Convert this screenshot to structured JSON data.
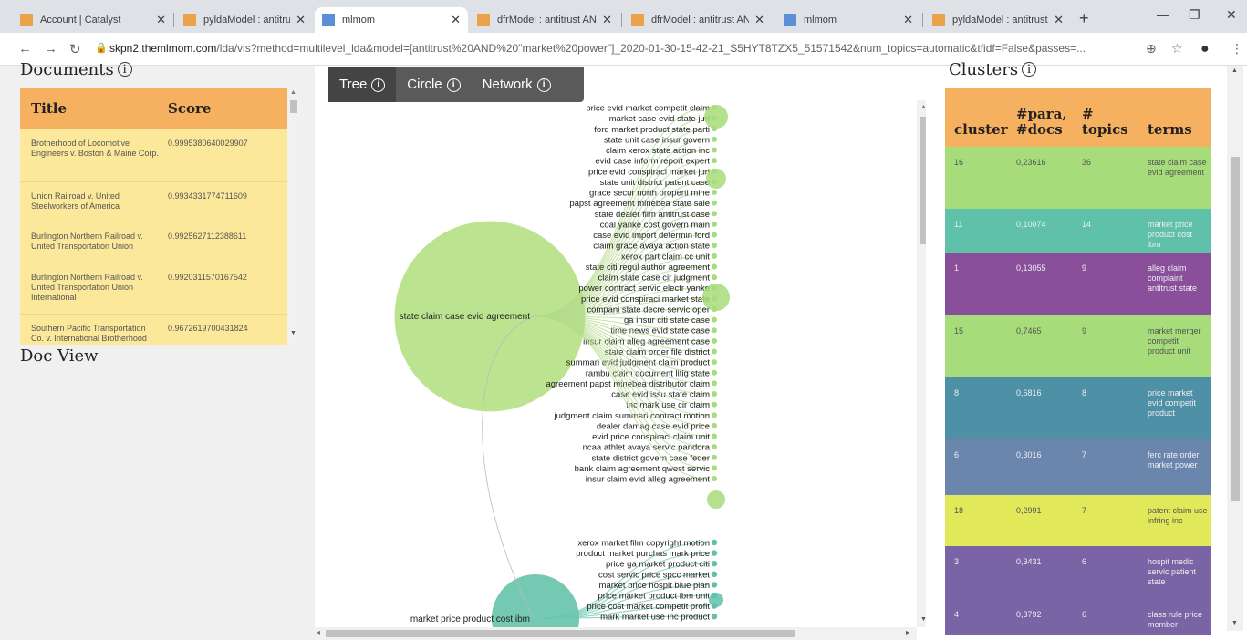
{
  "browser": {
    "tabs": [
      {
        "label": "Account | Catalyst",
        "active": false
      },
      {
        "label": "pyldaModel : antitrust",
        "active": false
      },
      {
        "label": "mlmom",
        "active": true
      },
      {
        "label": "dfrModel : antitrust AN",
        "active": false
      },
      {
        "label": "dfrModel : antitrust AN",
        "active": false
      },
      {
        "label": "mlmom",
        "active": false
      },
      {
        "label": "pyldaModel : antitrust",
        "active": false
      }
    ],
    "url_host": "skpn2.themlmom.com",
    "url_rest": "/lda/vis?method=multilevel_lda&model=[antitrust%20AND%20\"market%20power\"]_2020-01-30-15-42-21_S5HYT8TZX5_51571542&num_topics=automatic&tfidf=False&passes=..."
  },
  "documents": {
    "heading": "Documents",
    "col_title": "Title",
    "col_score": "Score",
    "rows": [
      {
        "title": "Brotherhood of Locomotive Engineers v. Boston & Maine Corp.",
        "score": "0.9995380640029907"
      },
      {
        "title": "Union Railroad v. United Steelworkers of America",
        "score": "0.9934331774711609"
      },
      {
        "title": "Burlington Northern Railroad v. United Transportation Union",
        "score": "0.9925627112388611"
      },
      {
        "title": "Burlington Northern Railroad v. United Transportation Union International",
        "score": "0.9920311570167542"
      },
      {
        "title": "Southern Pacific Transportation Co. v. International Brotherhood",
        "score": "0.9672619700431824"
      }
    ]
  },
  "docview": {
    "heading": "Doc View"
  },
  "viz": {
    "tabs": [
      {
        "label": "Tree",
        "active": true
      },
      {
        "label": "Circle",
        "active": false
      },
      {
        "label": "Network",
        "active": false
      }
    ],
    "root1": "state claim case evid agreement",
    "root2": "market price product cost ibm",
    "leaves1": [
      "price evid market competit claim",
      "market case evid state juri",
      "ford market product state parti",
      "state unit case insur govern",
      "claim xerox state action inc",
      "evid case inform report expert",
      "price evid conspiraci market juri",
      "state unit district patent case",
      "grace secur north properti mine",
      "papst agreement minebea state sale",
      "state dealer film antitrust case",
      "coal yanke cost govern main",
      "case evid import determin ford",
      "claim grace avaya action state",
      "xerox part claim cc unit",
      "state citi regul author agreement",
      "claim state case cir judgment",
      "power contract servic electr yanke",
      "price evid conspiraci market state",
      "compani state decre servic oper",
      "ga insur citi state case",
      "time news evid state case",
      "insur claim alleg agreement case",
      "state claim order file district",
      "summari evid judgment claim product",
      "rambu claim document litig state",
      "agreement papst minebea distributor claim",
      "case evid issu state claim",
      "inc mark use cir claim",
      "judgment claim summari contract motion",
      "dealer damag case evid price",
      "evid price conspiraci claim unit",
      "ncaa athlet avaya servic pandora",
      "state district govern case feder",
      "bank claim agreement qwest servic",
      "insur claim evid alleg agreement"
    ],
    "leaves2": [
      "xerox market film copyright motion",
      "product market purchas mark price",
      "price ga market product citi",
      "cost servic price spcc market",
      "market price hospit blue plan",
      "price market product ibm unit",
      "price cost market competit profit",
      "mark market use inc product"
    ]
  },
  "clusters": {
    "heading": "Clusters",
    "col_cluster": "cluster",
    "col_para": "#para, #docs",
    "col_topics": "# topics",
    "col_terms": "terms",
    "rows": [
      {
        "cluster": "16",
        "para": "0,23616",
        "topics": "36",
        "terms": "state claim case evid agreement",
        "color": "#a6dc7a"
      },
      {
        "cluster": "11",
        "para": "0,10074",
        "topics": "14",
        "terms": "market price product cost ibm",
        "color": "#5fc1aa"
      },
      {
        "cluster": "1",
        "para": "0,13055",
        "topics": "9",
        "terms": "alleg claim complaint antitrust state",
        "color": "#8a4f9b"
      },
      {
        "cluster": "15",
        "para": "0,7465",
        "topics": "9",
        "terms": "market merger competit product unit",
        "color": "#a6dc7a"
      },
      {
        "cluster": "8",
        "para": "0,6816",
        "topics": "8",
        "terms": "price market evid competit product",
        "color": "#4e90a6"
      },
      {
        "cluster": "6",
        "para": "0,3016",
        "topics": "7",
        "terms": "ferc rate order market power",
        "color": "#6a86ad"
      },
      {
        "cluster": "18",
        "para": "0,2991",
        "topics": "7",
        "terms": "patent claim use infring inc",
        "color": "#e1e85a"
      },
      {
        "cluster": "3",
        "para": "0,3431",
        "topics": "6",
        "terms": "hospit medic servic patient state",
        "color": "#7a64a6"
      },
      {
        "cluster": "4",
        "para": "0,3792",
        "topics": "6",
        "terms": "class rule price member",
        "color": "#7a64a6"
      }
    ]
  }
}
